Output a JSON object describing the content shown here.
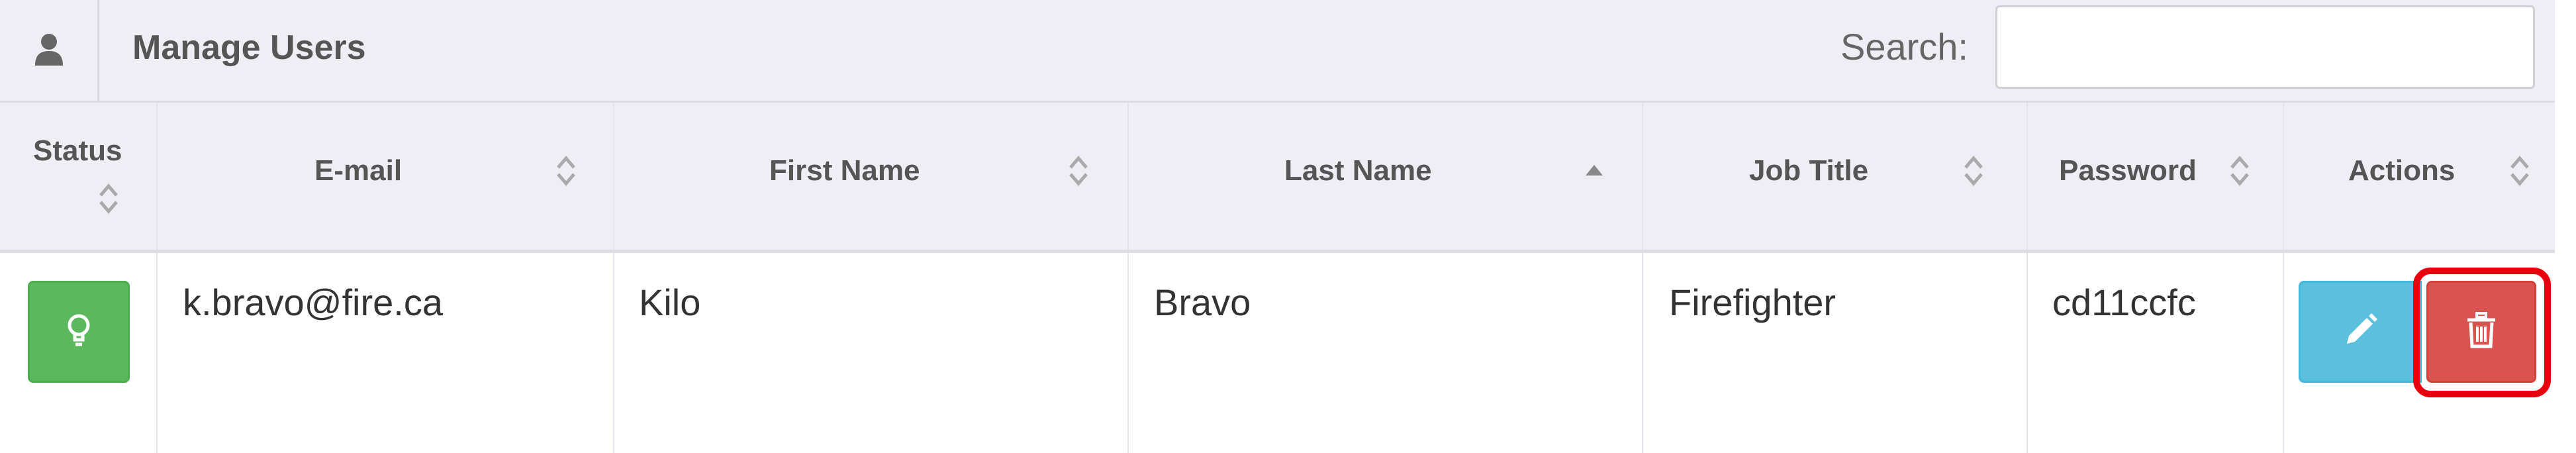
{
  "header": {
    "icon": "user-icon",
    "title": "Manage Users",
    "search_label": "Search:",
    "search_value": "",
    "search_placeholder": ""
  },
  "table": {
    "columns": [
      {
        "label": "Status",
        "sort": "both"
      },
      {
        "label": "E-mail",
        "sort": "both"
      },
      {
        "label": "First Name",
        "sort": "both"
      },
      {
        "label": "Last Name",
        "sort": "ascending"
      },
      {
        "label": "Job Title",
        "sort": "both"
      },
      {
        "label": "Password",
        "sort": "both"
      },
      {
        "label": "Actions",
        "sort": "both"
      }
    ],
    "rows": [
      {
        "status_icon": "lightbulb-icon",
        "status_color": "#5cb85c",
        "email": "k.bravo@fire.ca",
        "first_name": "Kilo",
        "last_name": "Bravo",
        "job_title": "Firefighter",
        "password": "cd11ccfc",
        "actions": [
          {
            "name": "edit",
            "icon": "pencil-icon",
            "color": "#5bc0de"
          },
          {
            "name": "delete",
            "icon": "trash-icon",
            "color": "#d9534f",
            "highlighted": true
          }
        ]
      }
    ]
  },
  "colors": {
    "header_bg": "#efeef4",
    "highlight": "#e8000f"
  }
}
